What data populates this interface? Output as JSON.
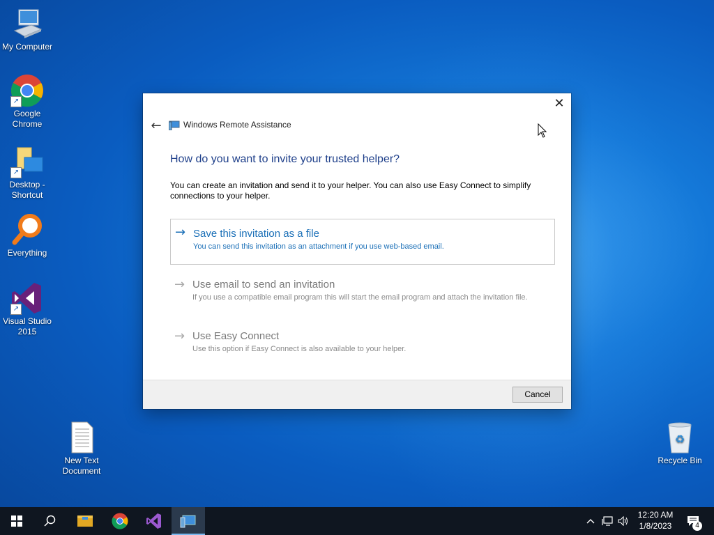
{
  "desktop": {
    "icons": [
      {
        "label": "My Computer"
      },
      {
        "label": "Google Chrome"
      },
      {
        "label": "Desktop - Shortcut"
      },
      {
        "label": "Everything"
      },
      {
        "label": "Visual Studio 2015"
      },
      {
        "label": "New Text Document"
      },
      {
        "label": "Recycle Bin"
      }
    ]
  },
  "dialog": {
    "app_title": "Windows Remote Assistance",
    "heading": "How do you want to invite your trusted helper?",
    "intro": "You can create an invitation and send it to your helper. You can also use Easy Connect to simplify connections to your helper.",
    "options": [
      {
        "title": "Save this invitation as a file",
        "desc": "You can send this invitation as an attachment if you use web-based email."
      },
      {
        "title": "Use email to send an invitation",
        "desc": "If you use a compatible email program this will start the email program and attach the invitation file."
      },
      {
        "title": "Use Easy Connect",
        "desc": "Use this option if Easy Connect is also available to your helper."
      }
    ],
    "cancel_label": "Cancel"
  },
  "taskbar": {
    "time": "12:20 AM",
    "date": "1/8/2023",
    "notification_count": "4"
  },
  "colors": {
    "accent": "#1a6fb7",
    "heading": "#1e3f8a",
    "taskbar": "#0f1620"
  }
}
